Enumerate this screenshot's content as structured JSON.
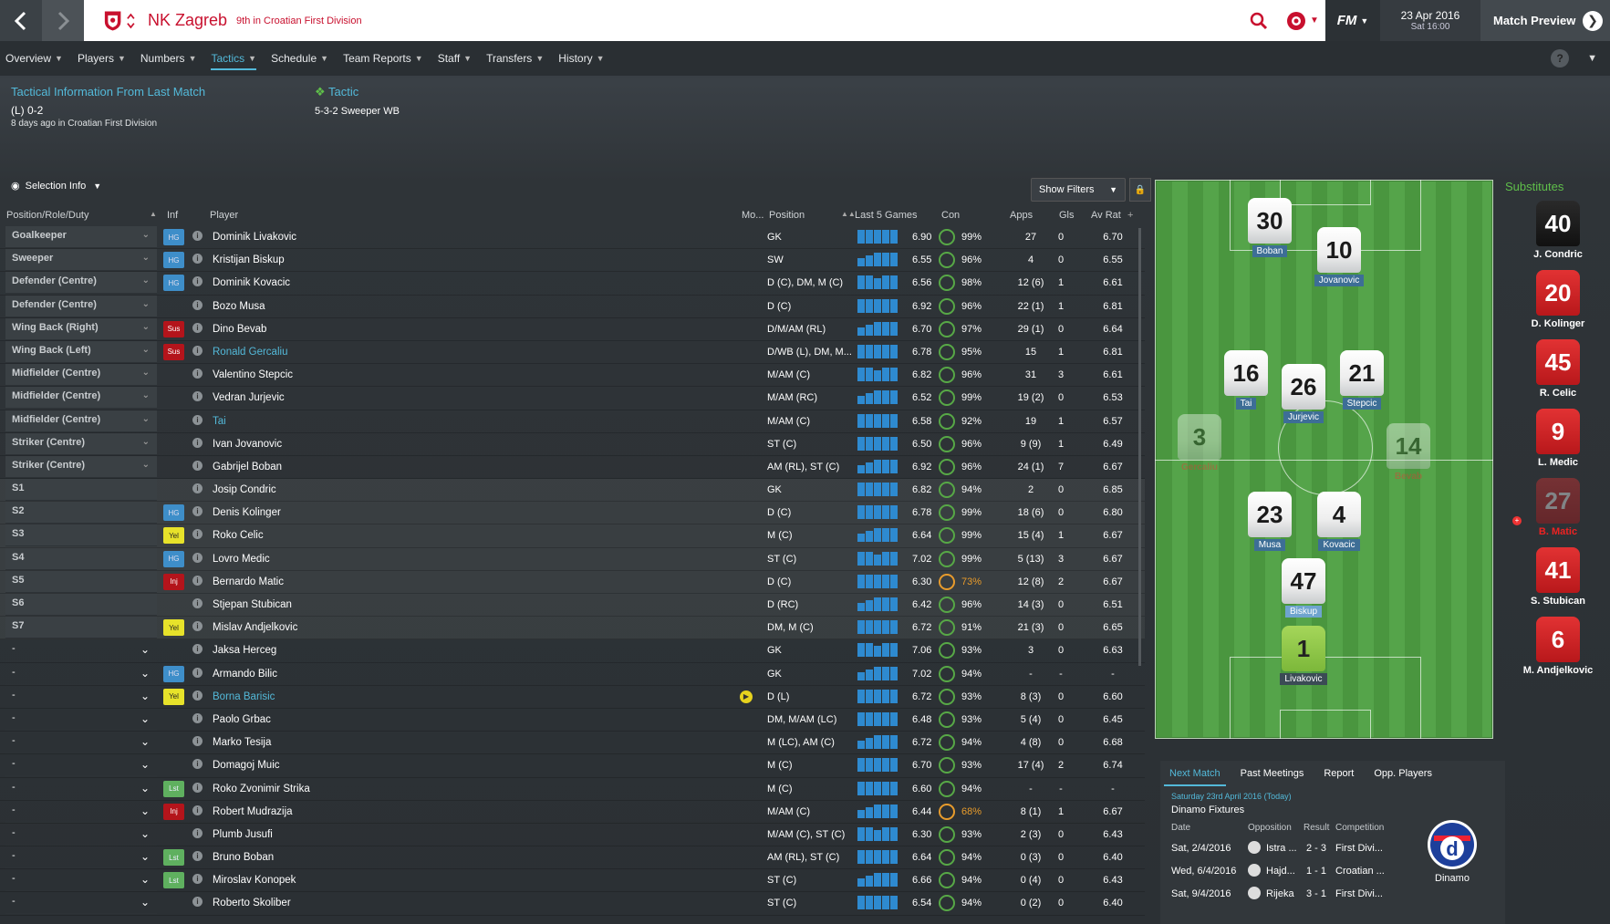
{
  "header": {
    "club_name": "NK Zagreb",
    "club_sub": "9th in Croatian First Division",
    "fm_label": "FM",
    "date": "23 Apr 2016",
    "time": "Sat 16:00",
    "match_preview": "Match Preview"
  },
  "nav": {
    "items": [
      "Overview",
      "Players",
      "Numbers",
      "Tactics",
      "Schedule",
      "Team Reports",
      "Staff",
      "Transfers",
      "History"
    ],
    "active": "Tactics"
  },
  "tactical": {
    "title": "Tactical Information From Last Match",
    "result": "(L) 0-2",
    "sub": "8 days ago in Croatian First Division",
    "tactic_label": "Tactic",
    "tactic_name": "5-3-2 Sweeper WB"
  },
  "toolbar": {
    "selection_info": "Selection Info",
    "show_filters": "Show Filters"
  },
  "columns": {
    "position": "Position/Role/Duty",
    "inf": "Inf",
    "player": "Player",
    "mo": "Mo...",
    "pos": "Position",
    "last5": "Last 5 Games",
    "con": "Con",
    "apps": "Apps",
    "gls": "Gls",
    "avrat": "Av Rat"
  },
  "rows": [
    {
      "slot": "Goalkeeper",
      "inf": "HG",
      "name": "Dominik Livakovic",
      "position": "GK",
      "last5": "6.90",
      "con": "99%",
      "apps": "27",
      "gls": "0",
      "avrat": "6.70"
    },
    {
      "slot": "Sweeper",
      "inf": "HG",
      "name": "Kristijan Biskup",
      "position": "SW",
      "last5": "6.55",
      "con": "96%",
      "apps": "4",
      "gls": "0",
      "avrat": "6.55"
    },
    {
      "slot": "Defender (Centre)",
      "inf": "HG",
      "name": "Dominik Kovacic",
      "position": "D (C), DM, M (C)",
      "last5": "6.56",
      "con": "98%",
      "apps": "12 (6)",
      "gls": "1",
      "avrat": "6.61"
    },
    {
      "slot": "Defender (Centre)",
      "inf": "",
      "name": "Bozo Musa",
      "position": "D (C)",
      "last5": "6.92",
      "con": "96%",
      "apps": "22 (1)",
      "gls": "1",
      "avrat": "6.81"
    },
    {
      "slot": "Wing Back (Right)",
      "inf": "Sus",
      "name": "Dino Bevab",
      "position": "D/M/AM (RL)",
      "last5": "6.70",
      "con": "97%",
      "apps": "29 (1)",
      "gls": "0",
      "avrat": "6.64"
    },
    {
      "slot": "Wing Back (Left)",
      "inf": "Sus",
      "name": "Ronald Gercaliu",
      "position": "D/WB (L), DM, M...",
      "last5": "6.78",
      "con": "95%",
      "apps": "15",
      "gls": "1",
      "avrat": "6.81",
      "link": true
    },
    {
      "slot": "Midfielder (Centre)",
      "inf": "",
      "name": "Valentino Stepcic",
      "position": "M/AM (C)",
      "last5": "6.82",
      "con": "96%",
      "apps": "31",
      "gls": "3",
      "avrat": "6.61"
    },
    {
      "slot": "Midfielder (Centre)",
      "inf": "",
      "name": "Vedran Jurjevic",
      "position": "M/AM (RC)",
      "last5": "6.52",
      "con": "99%",
      "apps": "19 (2)",
      "gls": "0",
      "avrat": "6.53"
    },
    {
      "slot": "Midfielder (Centre)",
      "inf": "",
      "name": "Tai",
      "position": "M/AM (C)",
      "last5": "6.58",
      "con": "92%",
      "apps": "19",
      "gls": "1",
      "avrat": "6.57",
      "link": true
    },
    {
      "slot": "Striker (Centre)",
      "inf": "",
      "name": "Ivan Jovanovic",
      "position": "ST (C)",
      "last5": "6.50",
      "con": "96%",
      "apps": "9 (9)",
      "gls": "1",
      "avrat": "6.49"
    },
    {
      "slot": "Striker (Centre)",
      "inf": "",
      "name": "Gabrijel Boban",
      "position": "AM (RL), ST (C)",
      "last5": "6.92",
      "con": "96%",
      "apps": "24 (1)",
      "gls": "7",
      "avrat": "6.67"
    },
    {
      "slot": "S1",
      "inf": "",
      "name": "Josip Condric",
      "position": "GK",
      "last5": "6.82",
      "con": "94%",
      "apps": "2",
      "gls": "0",
      "avrat": "6.85",
      "sub": true
    },
    {
      "slot": "S2",
      "inf": "HG",
      "name": "Denis Kolinger",
      "position": "D (C)",
      "last5": "6.78",
      "con": "99%",
      "apps": "18 (6)",
      "gls": "0",
      "avrat": "6.80",
      "sub": true
    },
    {
      "slot": "S3",
      "inf": "Yel",
      "name": "Roko Celic",
      "position": "M (C)",
      "last5": "6.64",
      "con": "99%",
      "apps": "15 (4)",
      "gls": "1",
      "avrat": "6.67",
      "sub": true
    },
    {
      "slot": "S4",
      "inf": "HG",
      "name": "Lovro Medic",
      "position": "ST (C)",
      "last5": "7.02",
      "con": "99%",
      "apps": "5 (13)",
      "gls": "3",
      "avrat": "6.67",
      "sub": true
    },
    {
      "slot": "S5",
      "inf": "Inj",
      "name": "Bernardo Matic",
      "position": "D (C)",
      "last5": "6.30",
      "con": "73%",
      "apps": "12 (8)",
      "gls": "2",
      "avrat": "6.67",
      "sub": true,
      "low": true
    },
    {
      "slot": "S6",
      "inf": "",
      "name": "Stjepan Stubican",
      "position": "D (RC)",
      "last5": "6.42",
      "con": "96%",
      "apps": "14 (3)",
      "gls": "0",
      "avrat": "6.51",
      "sub": true
    },
    {
      "slot": "S7",
      "inf": "Yel",
      "name": "Mislav Andjelkovic",
      "position": "DM, M (C)",
      "last5": "6.72",
      "con": "91%",
      "apps": "21 (3)",
      "gls": "0",
      "avrat": "6.65",
      "sub": true
    },
    {
      "slot": "-",
      "inf": "",
      "name": "Jaksa Herceg",
      "position": "GK",
      "last5": "7.06",
      "con": "93%",
      "apps": "3",
      "gls": "0",
      "avrat": "6.63",
      "res": true
    },
    {
      "slot": "-",
      "inf": "HG",
      "name": "Armando Bilic",
      "position": "GK",
      "last5": "7.02",
      "con": "94%",
      "apps": "-",
      "gls": "-",
      "avrat": "-",
      "res": true
    },
    {
      "slot": "-",
      "inf": "Yel",
      "name": "Borna Barisic",
      "position": "D (L)",
      "last5": "6.72",
      "con": "93%",
      "apps": "8 (3)",
      "gls": "0",
      "avrat": "6.60",
      "res": true,
      "link": true,
      "mo": true
    },
    {
      "slot": "-",
      "inf": "",
      "name": "Paolo Grbac",
      "position": "DM, M/AM (LC)",
      "last5": "6.48",
      "con": "93%",
      "apps": "5 (4)",
      "gls": "0",
      "avrat": "6.45",
      "res": true
    },
    {
      "slot": "-",
      "inf": "",
      "name": "Marko Tesija",
      "position": "M (LC), AM (C)",
      "last5": "6.72",
      "con": "94%",
      "apps": "4 (8)",
      "gls": "0",
      "avrat": "6.68",
      "res": true
    },
    {
      "slot": "-",
      "inf": "",
      "name": "Domagoj Muic",
      "position": "M (C)",
      "last5": "6.70",
      "con": "93%",
      "apps": "17 (4)",
      "gls": "2",
      "avrat": "6.74",
      "res": true
    },
    {
      "slot": "-",
      "inf": "Lst",
      "name": "Roko Zvonimir Strika",
      "position": "M (C)",
      "last5": "6.60",
      "con": "94%",
      "apps": "-",
      "gls": "-",
      "avrat": "-",
      "res": true
    },
    {
      "slot": "-",
      "inf": "Inj",
      "name": "Robert Mudrazija",
      "position": "M/AM (C)",
      "last5": "6.44",
      "con": "68%",
      "apps": "8 (1)",
      "gls": "1",
      "avrat": "6.67",
      "res": true,
      "low": true
    },
    {
      "slot": "-",
      "inf": "",
      "name": "Plumb Jusufi",
      "position": "M/AM (C), ST (C)",
      "last5": "6.30",
      "con": "93%",
      "apps": "2 (3)",
      "gls": "0",
      "avrat": "6.43",
      "res": true
    },
    {
      "slot": "-",
      "inf": "Lst",
      "name": "Bruno Boban",
      "position": "AM (RL), ST (C)",
      "last5": "6.64",
      "con": "94%",
      "apps": "0 (3)",
      "gls": "0",
      "avrat": "6.40",
      "res": true
    },
    {
      "slot": "-",
      "inf": "Lst",
      "name": "Miroslav Konopek",
      "position": "ST (C)",
      "last5": "6.66",
      "con": "94%",
      "apps": "0 (4)",
      "gls": "0",
      "avrat": "6.43",
      "res": true
    },
    {
      "slot": "-",
      "inf": "",
      "name": "Roberto Skoliber",
      "position": "ST (C)",
      "last5": "6.54",
      "con": "94%",
      "apps": "0 (2)",
      "gls": "0",
      "avrat": "6.40",
      "res": true
    }
  ],
  "pitch": {
    "players": [
      {
        "num": "30",
        "name": "Boban"
      },
      {
        "num": "10",
        "name": "Jovanovic"
      },
      {
        "num": "16",
        "name": "Tai"
      },
      {
        "num": "26",
        "name": "Jurjevic"
      },
      {
        "num": "21",
        "name": "Stepcic"
      },
      {
        "num": "3",
        "name": "Gercaliu"
      },
      {
        "num": "14",
        "name": "Bevab"
      },
      {
        "num": "23",
        "name": "Musa"
      },
      {
        "num": "4",
        "name": "Kovacic"
      },
      {
        "num": "47",
        "name": "Biskup"
      },
      {
        "num": "1",
        "name": "Livakovic"
      }
    ]
  },
  "subs": {
    "title": "Substitutes",
    "players": [
      {
        "num": "40",
        "name": "J. Condric"
      },
      {
        "num": "20",
        "name": "D. Kolinger"
      },
      {
        "num": "45",
        "name": "R. Celic"
      },
      {
        "num": "9",
        "name": "L. Medic"
      },
      {
        "num": "27",
        "name": "B. Matic"
      },
      {
        "num": "41",
        "name": "S. Stubican"
      },
      {
        "num": "6",
        "name": "M. Andjelkovic"
      }
    ]
  },
  "next_match": {
    "tabs": [
      "Next Match",
      "Past Meetings",
      "Report",
      "Opp. Players"
    ],
    "date": "Saturday 23rd April 2016 (Today)",
    "fixtures_title": "Dinamo Fixtures",
    "headers": [
      "Date",
      "Opposition",
      "Result",
      "Competition"
    ],
    "fixtures": [
      {
        "date": "Sat, 2/4/2016",
        "opp": "Istra ...",
        "res": "2 - 3",
        "comp": "First Divi..."
      },
      {
        "date": "Wed, 6/4/2016",
        "opp": "Hajd...",
        "res": "1 - 1",
        "comp": "Croatian ..."
      },
      {
        "date": "Sat, 9/4/2016",
        "opp": "Rijeka",
        "res": "3 - 1",
        "comp": "First Divi..."
      }
    ],
    "opponent": "Dinamo"
  },
  "colors": {
    "accent": "#53b9d9",
    "club_red": "#c8102e",
    "pitch": "#4a963f",
    "subs_green": "#5fbf4a"
  }
}
